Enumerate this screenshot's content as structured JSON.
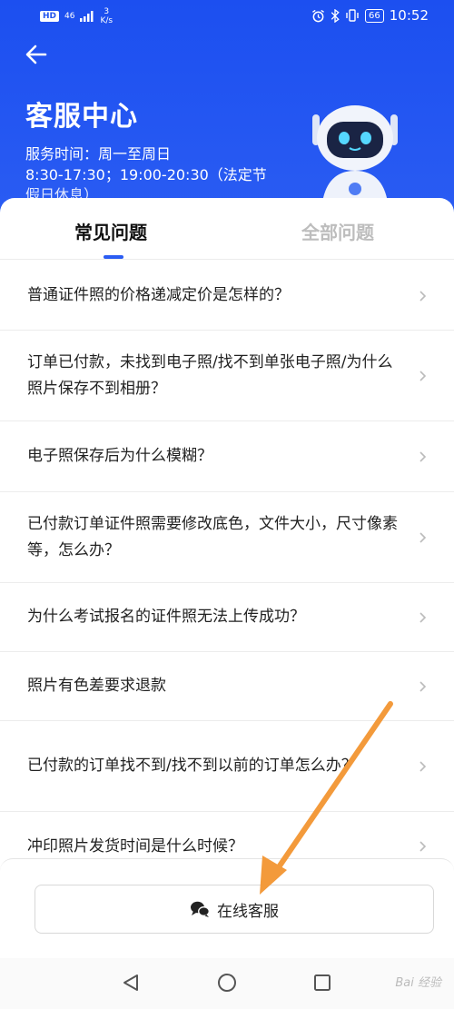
{
  "status_bar": {
    "hd": "HD",
    "signal": "46",
    "speed_value": "3",
    "speed_unit": "K/s",
    "battery": "66",
    "time": "10:52"
  },
  "header": {
    "title": "客服中心",
    "service_label": "服务时间：周一至周日",
    "service_hours": "8:30-17:30；19:00-20:30（法定节",
    "service_hours_cut": "假日休息）"
  },
  "tabs": [
    {
      "label": "常见问题",
      "active": true
    },
    {
      "label": "全部问题",
      "active": false
    }
  ],
  "faq": [
    {
      "text": "普通证件照的价格递减定价是怎样的？"
    },
    {
      "text": "订单已付款，未找到电子照/找不到单张电子照/为什么照片保存不到相册？"
    },
    {
      "text": "电子照保存后为什么模糊？"
    },
    {
      "text": "已付款订单证件照需要修改底色，文件大小，尺寸像素等，怎么办？"
    },
    {
      "text": "为什么考试报名的证件照无法上传成功？"
    },
    {
      "text": "照片有色差要求退款"
    },
    {
      "text": "已付款的订单找不到/找不到以前的订单怎么办？"
    },
    {
      "text": "冲印照片发货时间是什么时候？"
    }
  ],
  "online_service": {
    "label": "在线客服",
    "icon": "chat-bubbles-icon"
  },
  "nav": {
    "back": "back-triangle-icon",
    "home": "home-circle-icon",
    "recents": "recents-square-icon"
  },
  "watermark": "Bai 经验",
  "colors": {
    "brand_blue": "#2456ee",
    "annotation_arrow": "#f39a3b"
  }
}
